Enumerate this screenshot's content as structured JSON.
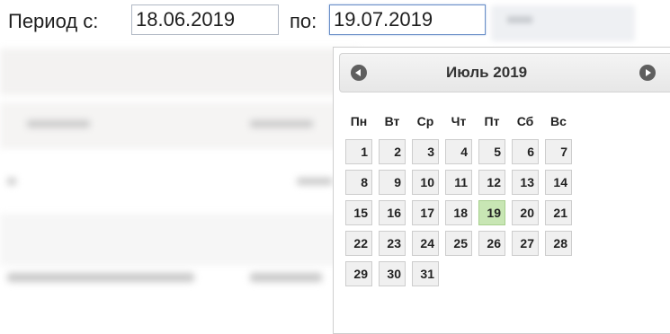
{
  "period": {
    "from_label": "Период с:",
    "from_value": "18.06.2019",
    "to_label": "по:",
    "to_value": "19.07.2019"
  },
  "calendar": {
    "month_title": "Июль 2019",
    "prev_icon": "chevron-left-icon",
    "next_icon": "chevron-right-icon",
    "weekdays": [
      "Пн",
      "Вт",
      "Ср",
      "Чт",
      "Пт",
      "Сб",
      "Вс"
    ],
    "weeks": [
      [
        "1",
        "2",
        "3",
        "4",
        "5",
        "6",
        "7"
      ],
      [
        "8",
        "9",
        "10",
        "11",
        "12",
        "13",
        "14"
      ],
      [
        "15",
        "16",
        "17",
        "18",
        "19",
        "20",
        "21"
      ],
      [
        "22",
        "23",
        "24",
        "25",
        "26",
        "27",
        "28"
      ],
      [
        "29",
        "30",
        "31",
        "",
        "",
        "",
        ""
      ]
    ],
    "selected_day": "19",
    "selected_color": "#c8e6b4"
  }
}
